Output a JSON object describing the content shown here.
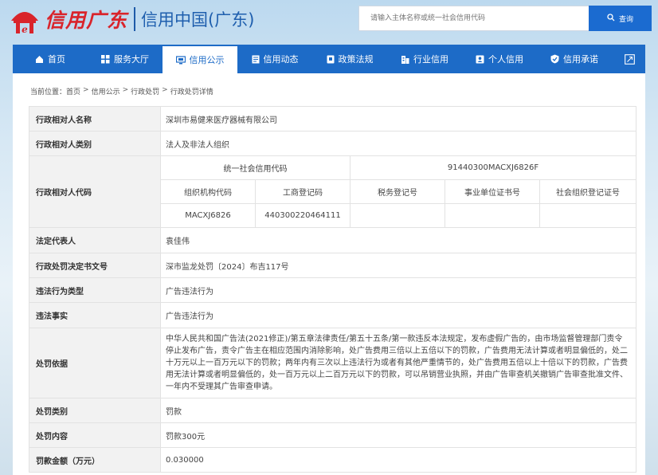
{
  "header": {
    "logo_script": "信用广东",
    "logo_text": "信用中国(广东)",
    "search_placeholder": "请输入主体名称或统一社会信用代码",
    "search_button": "查询"
  },
  "nav": [
    {
      "label": "首页",
      "icon": "home-icon"
    },
    {
      "label": "服务大厅",
      "icon": "grid-icon"
    },
    {
      "label": "信用公示",
      "icon": "display-icon",
      "active": true
    },
    {
      "label": "信用动态",
      "icon": "document-icon"
    },
    {
      "label": "政策法规",
      "icon": "book-icon"
    },
    {
      "label": "行业信用",
      "icon": "building-icon"
    },
    {
      "label": "个人信用",
      "icon": "id-card-icon"
    },
    {
      "label": "信用承诺",
      "icon": "shield-check-icon"
    }
  ],
  "breadcrumb": {
    "prefix": "当前位置：",
    "items": [
      "首页",
      "信用公示",
      "行政处罚",
      "行政处罚详情"
    ],
    "separator": ">"
  },
  "record": {
    "name_label": "行政相对人名称",
    "name_value": "深圳市易健来医疗器械有限公司",
    "type_label": "行政相对人类别",
    "type_value": "法人及非法人组织",
    "code_label": "行政相对人代码",
    "code_sub": {
      "uscc_label": "统一社会信用代码",
      "uscc_value": "91440300MACXJ6826F",
      "headers": [
        "组织机构代码",
        "工商登记码",
        "税务登记号",
        "事业单位证书号",
        "社会组织登记证号"
      ],
      "values": [
        "MACXJ6826",
        "440300220464111",
        "",
        "",
        ""
      ]
    },
    "rep_label": "法定代表人",
    "rep_value": "袁佳伟",
    "doc_label": "行政处罚决定书文号",
    "doc_value": "深市监龙处罚〔2024〕布吉117号",
    "violation_type_label": "违法行为类型",
    "violation_type_value": "广告违法行为",
    "facts_label": "违法事实",
    "facts_value": "广告违法行为",
    "basis_label": "处罚依据",
    "basis_value": "中华人民共和国广告法(2021修正)/第五章法律责任/第五十五条/第一款违反本法规定，发布虚假广告的，由市场监督管理部门责令停止发布广告，责令广告主在相应范围内消除影响，处广告费用三倍以上五倍以下的罚款，广告费用无法计算或者明显偏低的，处二十万元以上一百万元以下的罚款；两年内有三次以上违法行为或者有其他严重情节的，处广告费用五倍以上十倍以下的罚款，广告费用无法计算或者明显偏低的，处一百万元以上二百万元以下的罚款，可以吊销营业执照，并由广告审查机关撤销广告审查批准文件、一年内不受理其广告审查申请。",
    "category_label": "处罚类别",
    "category_value": "罚款",
    "content_label": "处罚内容",
    "content_value": "罚款300元",
    "amount_label": "罚款金额（万元）",
    "amount_value": "0.030000"
  },
  "colors": {
    "brand_blue": "#1d6bc7",
    "logo_red": "#d9242b",
    "label_bg": "#f2f2f2"
  }
}
